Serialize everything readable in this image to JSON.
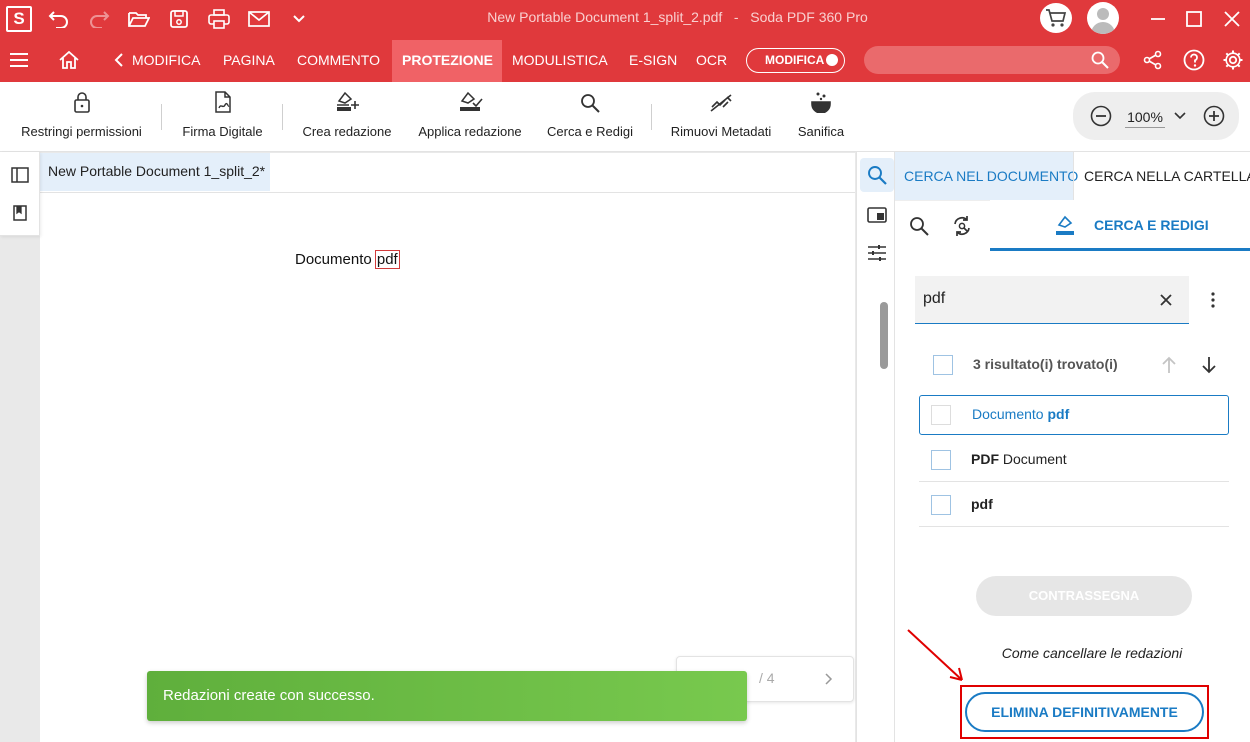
{
  "window": {
    "title": "New Portable Document 1_split_2.pdf   -   Soda PDF 360 Pro",
    "logo_letter": "S"
  },
  "menu": {
    "tabs": [
      "MODIFICA",
      "PAGINA",
      "COMMENTO",
      "PROTEZIONE",
      "MODULISTICA",
      "E-SIGN",
      "OCR"
    ],
    "active": "PROTEZIONE",
    "mode_toggle_label": "MODIFICA"
  },
  "toolbar": {
    "items": [
      {
        "label": "Restringi permissioni",
        "icon": "lock-icon"
      },
      {
        "label": "Firma Digitale",
        "icon": "digital-signature-icon"
      },
      {
        "label": "Crea redazione",
        "icon": "create-redaction-icon"
      },
      {
        "label": "Applica redazione",
        "icon": "apply-redaction-icon"
      },
      {
        "label": "Cerca e Redigi",
        "icon": "search-icon"
      },
      {
        "label": "Rimuovi Metadati",
        "icon": "remove-metadata-icon"
      },
      {
        "label": "Sanifica",
        "icon": "sanitize-icon"
      }
    ],
    "zoom": "100%"
  },
  "document": {
    "tab_title": "New Portable Document 1_split_2*",
    "text_before": "Documento ",
    "text_highlight": "pdf",
    "pager": "/ 4"
  },
  "toast": {
    "message": "Redazioni create con successo.",
    "color": "#6bbf45"
  },
  "panel": {
    "tabs": [
      "CERCA NEL DOCUMENTO",
      "CERCA NELLA CARTELLA"
    ],
    "subtab_active": "CERCA E REDIGI",
    "search_value": "pdf",
    "results_count": "3 risultato(i) trovato(i)",
    "results": [
      {
        "pre": "Documento ",
        "bold": "pdf",
        "post": ""
      },
      {
        "pre": "",
        "bold": "PDF",
        "post": " Document"
      },
      {
        "pre": "",
        "bold": "pdf",
        "post": ""
      }
    ],
    "mark_button": "CONTRASSEGNA",
    "help_link": "Come cancellare le redazioni",
    "delete_button": "ELIMINA DEFINITIVAMENTE"
  },
  "colors": {
    "brand": "#e0393c",
    "accent": "#1a7bc4",
    "annotation": "#e00000"
  }
}
